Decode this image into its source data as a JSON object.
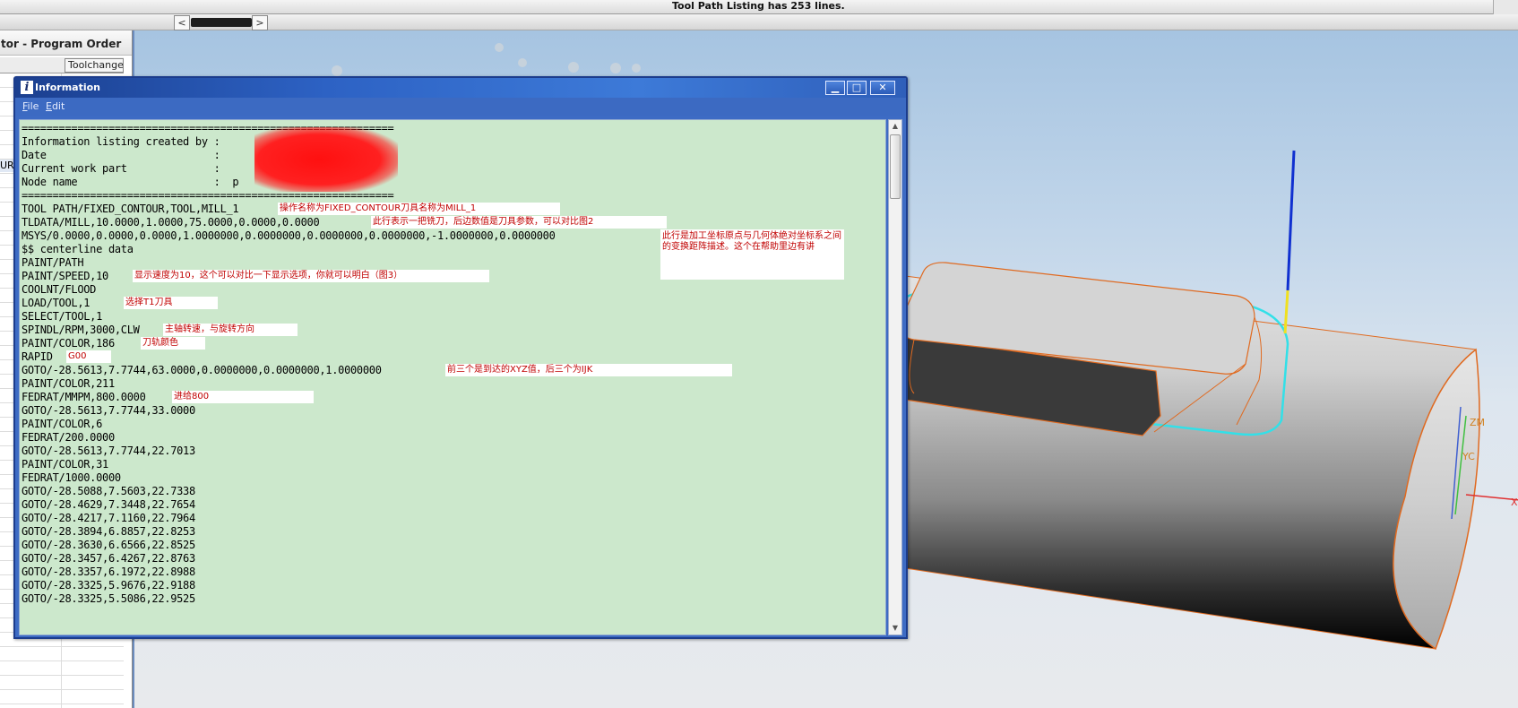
{
  "statusbar": {
    "text": "Tool Path Listing has 253 lines."
  },
  "scroll": {
    "left_arrow": "<",
    "right_arrow": ">"
  },
  "navigator": {
    "title": "tor - Program Order",
    "column_header": "Toolchange",
    "selected_row_text": "UR"
  },
  "info_window": {
    "title": "Information",
    "title_icon": "i",
    "buttons": {
      "minimize": "▁",
      "maximize": "□",
      "close": "✕"
    },
    "menu": [
      "File",
      "Edit"
    ]
  },
  "listing": [
    "============================================================",
    "Information listing created by :",
    "Date                           :",
    "Current work part              :",
    "Node name                      :  p",
    "============================================================",
    "TOOL PATH/FIXED_CONTOUR,TOOL,MILL_1",
    "TLDATA/MILL,10.0000,1.0000,75.0000,0.0000,0.0000",
    "MSYS/0.0000,0.0000,0.0000,1.0000000,0.0000000,0.0000000,0.0000000,-1.0000000,0.0000000",
    "$$ centerline data",
    "PAINT/PATH",
    "PAINT/SPEED,10",
    "COOLNT/FLOOD",
    "LOAD/TOOL,1",
    "SELECT/TOOL,1",
    "SPINDL/RPM,3000,CLW",
    "PAINT/COLOR,186",
    "RAPID",
    "GOTO/-28.5613,7.7744,63.0000,0.0000000,0.0000000,1.0000000",
    "PAINT/COLOR,211",
    "FEDRAT/MMPM,800.0000",
    "GOTO/-28.5613,7.7744,33.0000",
    "PAINT/COLOR,6",
    "FEDRAT/200.0000",
    "GOTO/-28.5613,7.7744,22.7013",
    "PAINT/COLOR,31",
    "FEDRAT/1000.0000",
    "GOTO/-28.5088,7.5603,22.7338",
    "GOTO/-28.4629,7.3448,22.7654",
    "GOTO/-28.4217,7.1160,22.7964",
    "GOTO/-28.3894,6.8857,22.8253",
    "GOTO/-28.3630,6.6566,22.8525",
    "GOTO/-28.3457,6.4267,22.8763",
    "GOTO/-28.3357,6.1972,22.8988",
    "GOTO/-28.3325,5.9676,22.9188",
    "GOTO/-28.3325,5.5086,22.9525"
  ],
  "annotations": {
    "a1": "操作名称为FIXED_CONTOUR刀具名称为MILL_1",
    "a2": "此行表示一把铣刀，后边数值是刀具参数，可以对比图2",
    "a3": "此行是加工坐标原点与几何体绝对坐标系之间的变换距阵描述。这个在帮助里边有讲",
    "a4": "显示速度为10，这个可以对比一下显示选项，你就可以明白（图3）",
    "a5": "选择T1刀具",
    "a6": "主轴转速，与旋转方向",
    "a7": "刀轨颜色",
    "a8": "G00",
    "a9": "前三个是到达的XYZ值，后三个为IJK",
    "a10": "进给800"
  },
  "axes": {
    "zm": "ZM",
    "yc": "YC",
    "xm": "XM"
  },
  "colors": {
    "listing_bg": "#cce8cc",
    "window_frame": "#3d6bc4",
    "note_text": "#c00000",
    "toolpath": "#32e0e8",
    "part_edge": "#e06a20"
  }
}
